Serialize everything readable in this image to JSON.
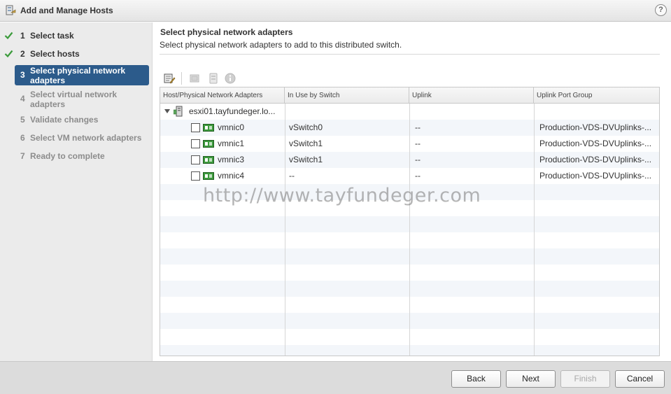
{
  "window": {
    "title": "Add and Manage Hosts",
    "help_label": "?"
  },
  "steps": [
    {
      "num": "1",
      "label": "Select task",
      "state": "done"
    },
    {
      "num": "2",
      "label": "Select hosts",
      "state": "done"
    },
    {
      "num": "3",
      "label": "Select physical network adapters",
      "state": "active"
    },
    {
      "num": "4",
      "label": "Select virtual network adapters",
      "state": "pending"
    },
    {
      "num": "5",
      "label": "Validate changes",
      "state": "pending"
    },
    {
      "num": "6",
      "label": "Select VM network adapters",
      "state": "pending"
    },
    {
      "num": "7",
      "label": "Ready to complete",
      "state": "pending"
    }
  ],
  "main": {
    "title": "Select physical network adapters",
    "subtitle": "Select physical network adapters to add to this distributed switch.",
    "toolbar": [
      "assign-uplink-icon",
      "unassign-icon",
      "view-settings-icon",
      "info-icon"
    ]
  },
  "table": {
    "columns": [
      "Host/Physical Network Adapters",
      "In Use by Switch",
      "Uplink",
      "Uplink Port Group"
    ],
    "host": "esxi01.tayfundeger.lo...",
    "rows": [
      {
        "adapter": "vmnic0",
        "switch": "vSwitch0",
        "uplink": "--",
        "port_group": "Production-VDS-DVUplinks-..."
      },
      {
        "adapter": "vmnic1",
        "switch": "vSwitch1",
        "uplink": "--",
        "port_group": "Production-VDS-DVUplinks-..."
      },
      {
        "adapter": "vmnic3",
        "switch": "vSwitch1",
        "uplink": "--",
        "port_group": "Production-VDS-DVUplinks-..."
      },
      {
        "adapter": "vmnic4",
        "switch": "--",
        "uplink": "--",
        "port_group": "Production-VDS-DVUplinks-..."
      }
    ]
  },
  "watermark": "http://www.tayfundeger.com",
  "buttons": {
    "back": "Back",
    "next": "Next",
    "finish": "Finish",
    "cancel": "Cancel"
  },
  "colors": {
    "active_step": "#2c5b8b",
    "check": "#3b9b3b",
    "nic_icon": "#3d9a3d"
  }
}
